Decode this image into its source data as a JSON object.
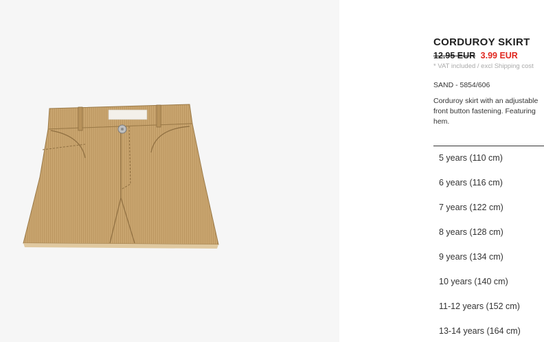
{
  "product": {
    "title": "CORDUROY SKIRT",
    "old_price": "12.95 EUR",
    "new_price": "3.99 EUR",
    "vat_note": "* VAT included / excl Shipping cost",
    "color_ref": "SAND - 5854/606",
    "description_lines": [
      "Corduroy skirt with an adjustable",
      "front button fastening. Featuring",
      "hem."
    ]
  },
  "sizes": [
    "5 years (110 cm)",
    "6 years (116 cm)",
    "7 years (122 cm)",
    "8 years (128 cm)",
    "9 years (134 cm)",
    "10 years (140 cm)",
    "11-12 years (152 cm)",
    "13-14 years (164 cm)"
  ],
  "colors": {
    "accent_price": "#e0271f",
    "image_background": "#f6f6f6",
    "skirt": "#c9a56f"
  }
}
